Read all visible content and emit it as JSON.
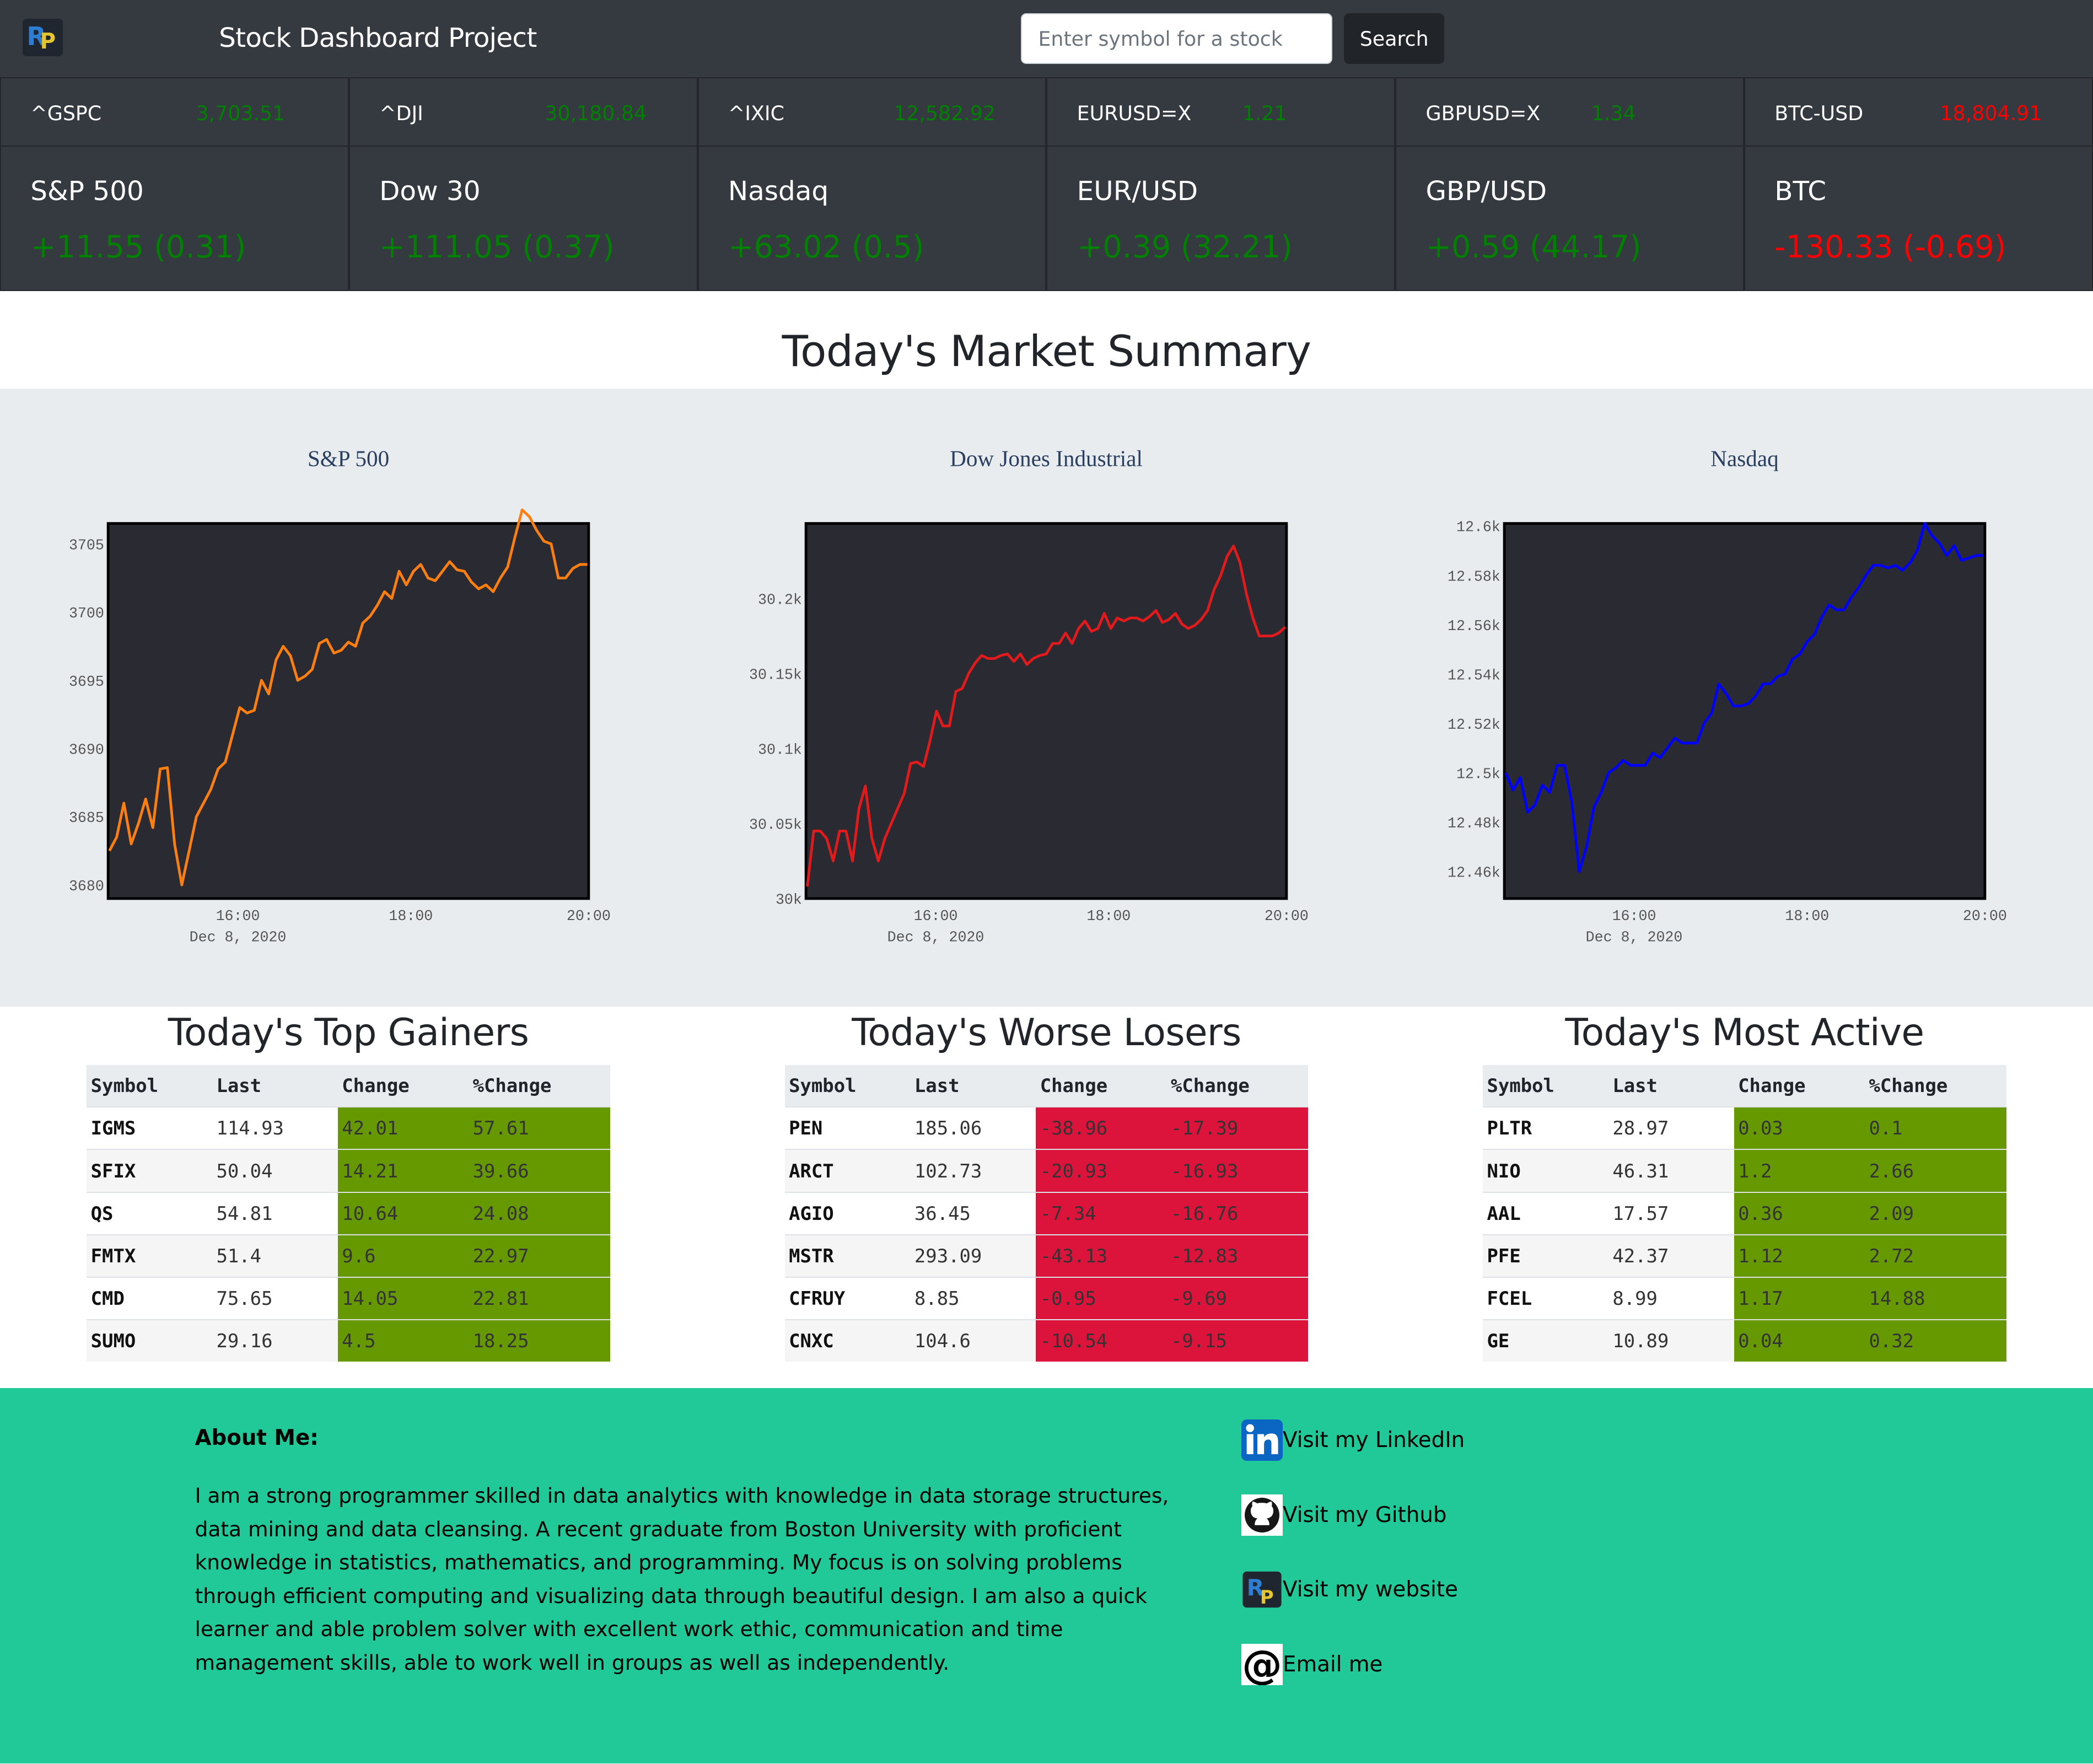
{
  "header": {
    "title": "Stock Dashboard Project",
    "search_placeholder": "Enter symbol for a stock",
    "search_button": "Search"
  },
  "tickers": [
    {
      "symbol": "^GSPC",
      "price": "3,703.51",
      "name": "S&P 500",
      "change": "+11.55 (0.31)",
      "direction": "up"
    },
    {
      "symbol": "^DJI",
      "price": "30,180.84",
      "name": "Dow 30",
      "change": "+111.05 (0.37)",
      "direction": "up"
    },
    {
      "symbol": "^IXIC",
      "price": "12,582.92",
      "name": "Nasdaq",
      "change": "+63.02 (0.5)",
      "direction": "up"
    },
    {
      "symbol": "EURUSD=X",
      "price": "1.21",
      "name": "EUR/USD",
      "change": "+0.39 (32.21)",
      "direction": "up"
    },
    {
      "symbol": "GBPUSD=X",
      "price": "1.34",
      "name": "GBP/USD",
      "change": "+0.59 (44.17)",
      "direction": "up"
    },
    {
      "symbol": "BTC-USD",
      "price": "18,804.91",
      "name": "BTC",
      "change": "-130.33 (-0.69)",
      "direction": "down"
    }
  ],
  "summary_title": "Today's Market Summary",
  "chart_data": [
    {
      "type": "line",
      "title": "S&P 500",
      "color": "#ff7f0e",
      "xticks": [
        "16:00",
        "18:00",
        "20:00"
      ],
      "xsub": "Dec 8, 2020",
      "ylim": [
        3679,
        3706.5
      ],
      "yticks": [
        3680,
        3685,
        3690,
        3695,
        3700,
        3705
      ],
      "ytick_labels": [
        "3680",
        "3685",
        "3690",
        "3695",
        "3700",
        "3705"
      ],
      "values": [
        3682.5,
        3683.5,
        3686,
        3683,
        3684.5,
        3686.3,
        3684.2,
        3688.5,
        3688.6,
        3683,
        3680,
        3682.5,
        3685,
        3686,
        3687,
        3688.5,
        3689,
        3691,
        3693,
        3692.6,
        3692.8,
        3695,
        3694,
        3696.5,
        3697.5,
        3696.8,
        3695,
        3695.3,
        3695.8,
        3697.7,
        3698,
        3697,
        3697.2,
        3697.8,
        3697.5,
        3699.2,
        3699.7,
        3700.5,
        3701.5,
        3701,
        3703,
        3702,
        3703,
        3703.5,
        3702.5,
        3702.3,
        3703,
        3703.7,
        3703.1,
        3703,
        3702.2,
        3701.7,
        3702,
        3701.5,
        3702.5,
        3703.3,
        3705.5,
        3707.5,
        3707,
        3706,
        3705.2,
        3705,
        3702.5,
        3702.5,
        3703.2,
        3703.5,
        3703.5
      ]
    },
    {
      "type": "line",
      "title": "Dow Jones Industrial",
      "color": "#e31a1c",
      "xticks": [
        "16:00",
        "18:00",
        "20:00"
      ],
      "xsub": "Dec 8, 2020",
      "ylim": [
        30000,
        30250
      ],
      "yticks": [
        30000,
        30050,
        30100,
        30150,
        30200
      ],
      "ytick_labels": [
        "30k",
        "30.05k",
        "30.1k",
        "30.15k",
        "30.2k"
      ],
      "values": [
        30008,
        30045,
        30045,
        30040,
        30025,
        30045,
        30045,
        30025,
        30060,
        30075,
        30040,
        30025,
        30040,
        30050,
        30060,
        30070,
        30090,
        30091,
        30088,
        30105,
        30125,
        30115,
        30115,
        30138,
        30140,
        30150,
        30157,
        30162,
        30160,
        30160,
        30162,
        30163,
        30158,
        30163,
        30156,
        30160,
        30162,
        30163,
        30170,
        30170,
        30177,
        30170,
        30180,
        30185,
        30178,
        30180,
        30190,
        30180,
        30187,
        30185,
        30187,
        30187,
        30185,
        30188,
        30192,
        30184,
        30186,
        30190,
        30183,
        30180,
        30182,
        30186,
        30192,
        30206,
        30215,
        30228,
        30235,
        30224,
        30203,
        30187,
        30175,
        30175,
        30175,
        30177,
        30181
      ]
    },
    {
      "type": "line",
      "title": "Nasdaq",
      "color": "#0000ff",
      "xticks": [
        "16:00",
        "18:00",
        "20:00"
      ],
      "xsub": "Dec 8, 2020",
      "ylim": [
        12449,
        12601
      ],
      "yticks": [
        12460,
        12480,
        12500,
        12520,
        12540,
        12560,
        12580,
        12600
      ],
      "ytick_labels": [
        "12.46k",
        "12.48k",
        "12.5k",
        "12.52k",
        "12.54k",
        "12.56k",
        "12.58k",
        "12.6k"
      ],
      "values": [
        12500,
        12493,
        12498,
        12484,
        12487,
        12495,
        12492,
        12503,
        12503,
        12488,
        12460,
        12470,
        12486,
        12492,
        12500,
        12502,
        12505,
        12503,
        12503,
        12503,
        12508,
        12506,
        12510,
        12514,
        12512,
        12512,
        12512,
        12520,
        12524,
        12536,
        12532,
        12527,
        12527,
        12528,
        12531,
        12536,
        12536,
        12539,
        12540,
        12546,
        12548,
        12553,
        12556,
        12563,
        12568,
        12566,
        12566,
        12571,
        12575,
        12580,
        12584,
        12584,
        12583,
        12584,
        12582,
        12585,
        12590,
        12601,
        12596,
        12593,
        12588,
        12592,
        12586,
        12587,
        12588,
        12588
      ]
    }
  ],
  "tables": {
    "gainers": {
      "title": "Today's Top Gainers",
      "columns": [
        "Symbol",
        "Last",
        "Change",
        "%Change"
      ],
      "rows": [
        [
          "IGMS",
          "114.93",
          "42.01",
          "57.61"
        ],
        [
          "SFIX",
          "50.04",
          "14.21",
          "39.66"
        ],
        [
          "QS",
          "54.81",
          "10.64",
          "24.08"
        ],
        [
          "FMTX",
          "51.4",
          "9.6",
          "22.97"
        ],
        [
          "CMD",
          "75.65",
          "14.05",
          "22.81"
        ],
        [
          "SUMO",
          "29.16",
          "4.5",
          "18.25"
        ]
      ]
    },
    "losers": {
      "title": "Today's Worse Losers",
      "columns": [
        "Symbol",
        "Last",
        "Change",
        "%Change"
      ],
      "rows": [
        [
          "PEN",
          "185.06",
          "-38.96",
          "-17.39"
        ],
        [
          "ARCT",
          "102.73",
          "-20.93",
          "-16.93"
        ],
        [
          "AGIO",
          "36.45",
          "-7.34",
          "-16.76"
        ],
        [
          "MSTR",
          "293.09",
          "-43.13",
          "-12.83"
        ],
        [
          "CFRUY",
          "8.85",
          "-0.95",
          "-9.69"
        ],
        [
          "CNXC",
          "104.6",
          "-10.54",
          "-9.15"
        ]
      ]
    },
    "active": {
      "title": "Today's Most Active",
      "columns": [
        "Symbol",
        "Last",
        "Change",
        "%Change"
      ],
      "rows": [
        [
          "PLTR",
          "28.97",
          "0.03",
          "0.1"
        ],
        [
          "NIO",
          "46.31",
          "1.2",
          "2.66"
        ],
        [
          "AAL",
          "17.57",
          "0.36",
          "2.09"
        ],
        [
          "PFE",
          "42.37",
          "1.12",
          "2.72"
        ],
        [
          "FCEL",
          "8.99",
          "1.17",
          "14.88"
        ],
        [
          "GE",
          "10.89",
          "0.04",
          "0.32"
        ]
      ]
    }
  },
  "footer": {
    "about_title": "About Me:",
    "about_text": "I am a strong programmer skilled in data analytics with knowledge in data storage structures, data mining and data cleansing. A recent graduate from Boston University with proficient knowledge in statistics, mathematics, and programming. My focus is on solving problems through efficient computing and visualizing data through beautiful design. I am also a quick learner and able problem solver with excellent work ethic, communication and time management skills, able to work well in groups as well as independently.",
    "links": [
      {
        "label": "Visit my LinkedIn",
        "icon": "linkedin-icon"
      },
      {
        "label": "Visit my Github",
        "icon": "github-icon"
      },
      {
        "label": "Visit my website",
        "icon": "website-logo-icon"
      },
      {
        "label": "Email me",
        "icon": "at-sign-icon"
      }
    ]
  },
  "colors": {
    "navbar": "#343a40",
    "gain": "#669900",
    "loss": "#dc143c",
    "footer": "#20c997",
    "chart_bg": "#2a2a32"
  }
}
